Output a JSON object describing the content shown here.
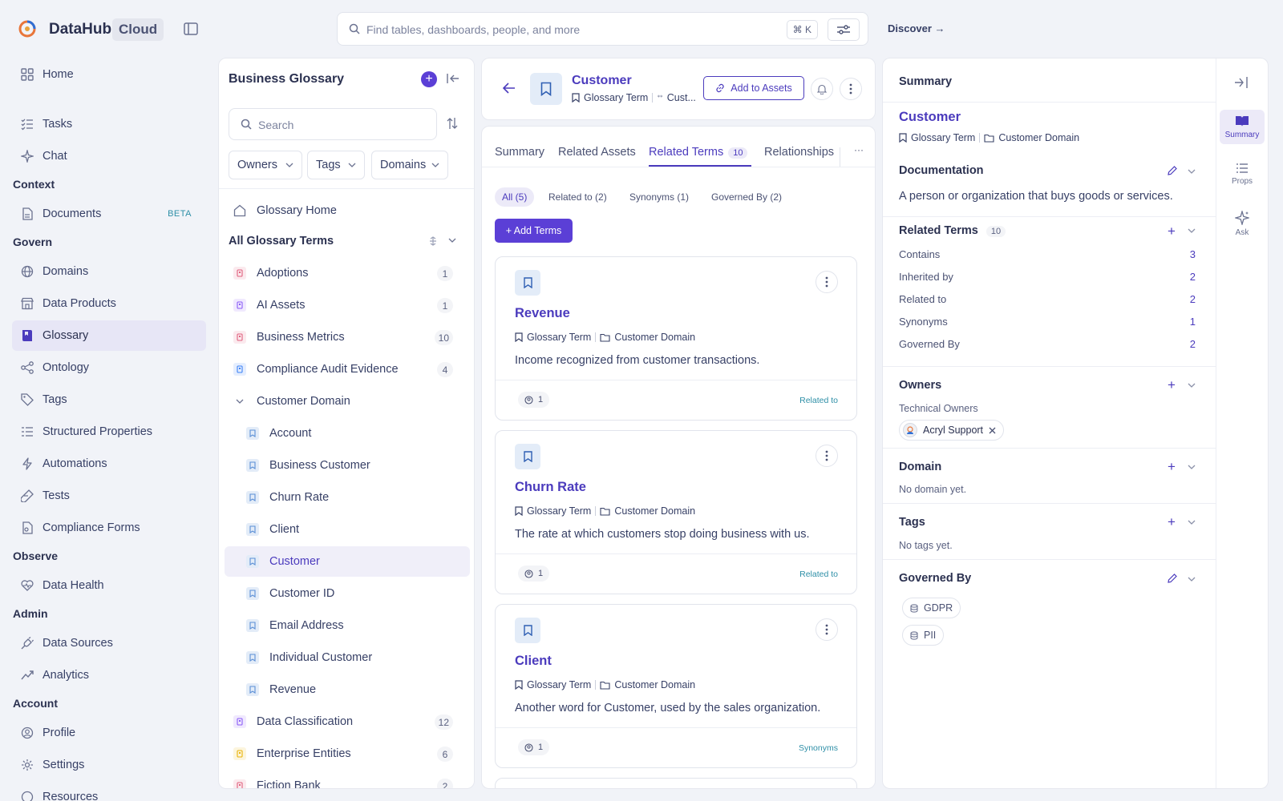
{
  "header": {
    "brand": "DataHub",
    "brand_tag": "Cloud",
    "search_placeholder": "Find tables, dashboards, people, and more",
    "search_shortcut": "⌘ K",
    "discover": "Discover →"
  },
  "nav": {
    "home": "Home",
    "tasks": "Tasks",
    "chat": "Chat",
    "section_context": "Context",
    "documents": "Documents",
    "documents_badge": "BETA",
    "section_govern": "Govern",
    "domains": "Domains",
    "data_products": "Data Products",
    "glossary": "Glossary",
    "ontology": "Ontology",
    "tags": "Tags",
    "structured_properties": "Structured Properties",
    "automations": "Automations",
    "tests": "Tests",
    "compliance_forms": "Compliance Forms",
    "section_observe": "Observe",
    "data_health": "Data Health",
    "section_admin": "Admin",
    "data_sources": "Data Sources",
    "analytics": "Analytics",
    "section_account": "Account",
    "profile": "Profile",
    "settings": "Settings",
    "resources": "Resources"
  },
  "glossary_panel": {
    "title": "Business Glossary",
    "search_placeholder": "Search",
    "filters": [
      "Owners",
      "Tags",
      "Domains"
    ],
    "home": "Glossary Home",
    "all_terms": "All Glossary Terms",
    "nodes": [
      {
        "label": "Adoptions",
        "count": "1",
        "color": "#e0607e"
      },
      {
        "label": "AI Assets",
        "count": "1",
        "color": "#8b5cf6"
      },
      {
        "label": "Business Metrics",
        "count": "10",
        "color": "#e0607e"
      },
      {
        "label": "Compliance Audit Evidence",
        "count": "4",
        "color": "#3b82f6"
      },
      {
        "label": "Customer Domain"
      },
      {
        "label": "Account"
      },
      {
        "label": "Business Customer"
      },
      {
        "label": "Churn Rate"
      },
      {
        "label": "Client"
      },
      {
        "label": "Customer"
      },
      {
        "label": "Customer ID"
      },
      {
        "label": "Email Address"
      },
      {
        "label": "Individual Customer"
      },
      {
        "label": "Revenue"
      },
      {
        "label": "Data Classification",
        "count": "12",
        "color": "#8b5cf6"
      },
      {
        "label": "Enterprise Entities",
        "count": "6",
        "color": "#eab308"
      },
      {
        "label": "Fiction Bank",
        "count": "2",
        "color": "#e0607e"
      }
    ]
  },
  "entity": {
    "name": "Customer",
    "type": "Glossary Term",
    "parent_short": "Cust...",
    "add_to_assets": "Add to Assets"
  },
  "tabs": {
    "summary": "Summary",
    "related_assets": "Related Assets",
    "related_terms": "Related Terms",
    "related_terms_count": "10",
    "relationships": "Relationships",
    "more": "···"
  },
  "term_filters": [
    "All (5)",
    "Related to (2)",
    "Synonyms (1)",
    "Governed By (2)"
  ],
  "add_terms": "+ Add Terms",
  "term_cards": [
    {
      "name": "Revenue",
      "type": "Glossary Term",
      "domain": "Customer Domain",
      "description": "Income recognized from customer transactions.",
      "owners": "1",
      "relation": "Related to"
    },
    {
      "name": "Churn Rate",
      "type": "Glossary Term",
      "domain": "Customer Domain",
      "description": "The rate at which customers stop doing business with us.",
      "owners": "1",
      "relation": "Related to"
    },
    {
      "name": "Client",
      "type": "Glossary Term",
      "domain": "Customer Domain",
      "description": "Another word for Customer, used by the sales organization.",
      "owners": "1",
      "relation": "Synonyms"
    }
  ],
  "summary": {
    "title": "Summary",
    "name": "Customer",
    "type": "Glossary Term",
    "domain": "Customer Domain",
    "documentation_title": "Documentation",
    "documentation": "A person or organization that buys goods or services.",
    "related_terms_title": "Related Terms",
    "related_terms_count": "10",
    "related": [
      {
        "label": "Contains",
        "value": "3"
      },
      {
        "label": "Inherited by",
        "value": "2"
      },
      {
        "label": "Related to",
        "value": "2"
      },
      {
        "label": "Synonyms",
        "value": "1"
      },
      {
        "label": "Governed By",
        "value": "2"
      }
    ],
    "owners_title": "Owners",
    "owners_sub": "Technical Owners",
    "owner": "Acryl Support",
    "domain_title": "Domain",
    "domain_empty": "No domain yet.",
    "tags_title": "Tags",
    "tags_empty": "No tags yet.",
    "governed_title": "Governed By",
    "governed": [
      "GDPR",
      "PII"
    ]
  },
  "rail": {
    "summary": "Summary",
    "props": "Props",
    "ask": "Ask"
  }
}
